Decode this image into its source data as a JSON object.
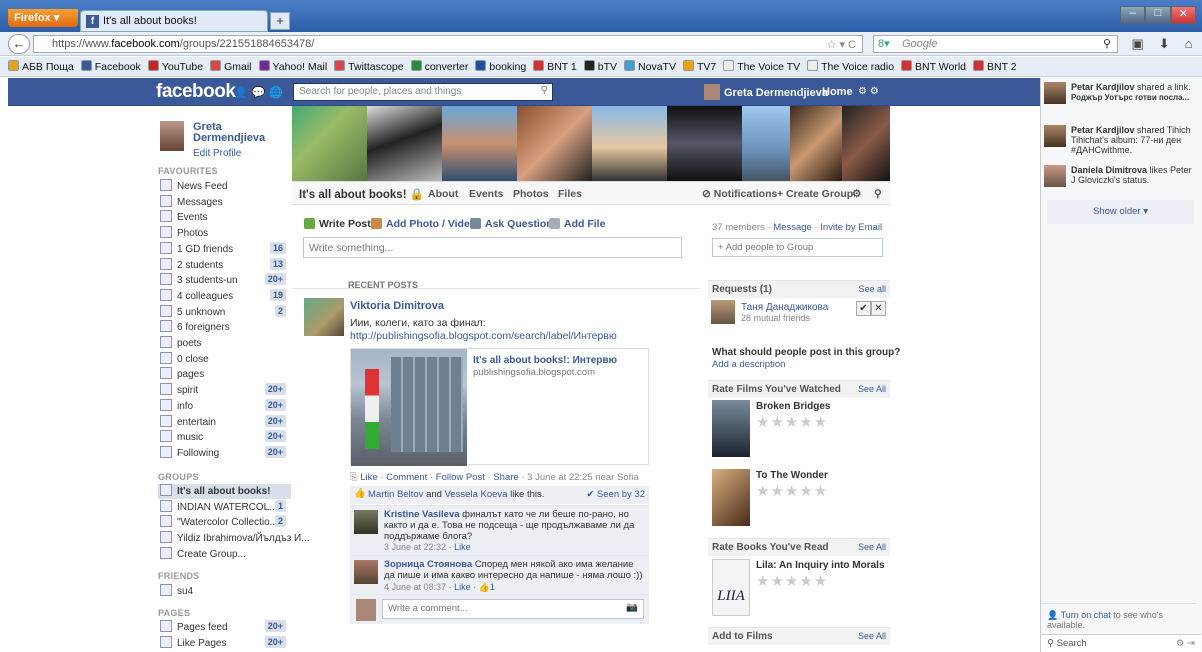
{
  "browser": {
    "menu_button": "Firefox",
    "tab_title": "It's all about books!",
    "url_prefix": "https://www.",
    "url_host": "facebook.com",
    "url_path": "/groups/221551884653478/",
    "search_engine_placeholder": "Google",
    "bookmarks": [
      {
        "label": "АБВ Поща",
        "color": "#e8a21a"
      },
      {
        "label": "Facebook",
        "color": "#3b5998"
      },
      {
        "label": "YouTube",
        "color": "#cc2222"
      },
      {
        "label": "Gmail",
        "color": "#d44"
      },
      {
        "label": "Yahoo! Mail",
        "color": "#6b2d91"
      },
      {
        "label": "Twittascope",
        "color": "#e04050"
      },
      {
        "label": "converter",
        "color": "#2a8a3a"
      },
      {
        "label": "booking",
        "color": "#1f4e9c"
      },
      {
        "label": "BNT 1",
        "color": "#c33"
      },
      {
        "label": "bTV",
        "color": "#222"
      },
      {
        "label": "NovaTV",
        "color": "#3aa0d8"
      },
      {
        "label": "TV7",
        "color": "#e8a21a"
      },
      {
        "label": "The Voice TV",
        "color": "#eee"
      },
      {
        "label": "The Voice radio",
        "color": "#eee"
      },
      {
        "label": "BNT World",
        "color": "#c33"
      },
      {
        "label": "BNT 2",
        "color": "#c33"
      }
    ]
  },
  "facebook": {
    "logo": "facebook",
    "search_placeholder": "Search for people, places and things",
    "user_name": "Greta Dermendjieva",
    "home": "Home"
  },
  "sidebar": {
    "profile_name": "Greta Dermendjieva",
    "edit_profile": "Edit Profile",
    "favourites_header": "FAVOURITES",
    "favourites": [
      {
        "label": "News Feed",
        "count": ""
      },
      {
        "label": "Messages",
        "count": ""
      },
      {
        "label": "Events",
        "count": ""
      },
      {
        "label": "Photos",
        "count": ""
      },
      {
        "label": "1 GD friends",
        "count": "16"
      },
      {
        "label": "2 students",
        "count": "13"
      },
      {
        "label": "3 students-un",
        "count": "20+"
      },
      {
        "label": "4 colleagues",
        "count": "19"
      },
      {
        "label": "5 unknown",
        "count": "2"
      },
      {
        "label": "6 foreigners",
        "count": ""
      },
      {
        "label": "poets",
        "count": ""
      },
      {
        "label": "0 close",
        "count": ""
      },
      {
        "label": "pages",
        "count": ""
      },
      {
        "label": "spirit",
        "count": "20+"
      },
      {
        "label": "info",
        "count": "20+"
      },
      {
        "label": "entertain",
        "count": "20+"
      },
      {
        "label": "music",
        "count": "20+"
      },
      {
        "label": "Following",
        "count": "20+"
      }
    ],
    "groups_header": "GROUPS",
    "groups": [
      {
        "label": "It's all about books!",
        "count": ""
      },
      {
        "label": "INDIAN WATERCOL...",
        "count": "1"
      },
      {
        "label": "\"Watercolor Collectio...",
        "count": "2"
      },
      {
        "label": "Yildiz Ibrahimova/Йълдъз И...",
        "count": ""
      },
      {
        "label": "Create Group...",
        "count": ""
      }
    ],
    "friends_header": "FRIENDS",
    "friends": [
      {
        "label": "su4",
        "count": ""
      }
    ],
    "pages_header": "PAGES",
    "pages": [
      {
        "label": "Pages feed",
        "count": "20+"
      },
      {
        "label": "Like Pages",
        "count": "20+"
      }
    ]
  },
  "group": {
    "title": "It's all about books!",
    "tabs": [
      "About",
      "Events",
      "Photos",
      "Files"
    ],
    "notifications": "Notifications",
    "create_group": "+ Create Group",
    "composer": [
      "Write Post",
      "Add Photo / Video",
      "Ask Question",
      "Add File"
    ],
    "write_placeholder": "Write something...",
    "recent_posts": "RECENT POSTS"
  },
  "post": {
    "author": "Viktoria Dimitrova",
    "text": "Иии, колеги, като за финал:",
    "link": "http://publishingsofia.blogspot.com/search/label/Интервю",
    "attachment_title": "It's all about books!: Интервю",
    "attachment_url": "publishingsofia.blogspot.com",
    "actions": {
      "like": "Like",
      "comment": "Comment",
      "follow": "Follow Post",
      "share": "Share",
      "meta": "3 June at 22:25 near Sofia"
    },
    "likers_a": "Martin Beltov",
    "likers_and": "and",
    "likers_b": "Vessela Koeva",
    "likers_suffix": "like this.",
    "seen_by": "Seen by 32",
    "comments": [
      {
        "name": "Kristine Vasileva",
        "text": "финалът като че ли беше по-рано, но както и да е. Това не подсеща - ще продължаваме ли да поддържаме блога?",
        "time": "3 June at 22:32",
        "like": "Like"
      },
      {
        "name": "Зорница Стоянова",
        "text": "Според мен някой ако има желание да пише и има какво интересно да напише - няма лошо :))",
        "time": "4 June at 08:37",
        "like": "Like",
        "likes": "1"
      }
    ],
    "write_comment": "Write a comment..."
  },
  "right": {
    "members": "37 members",
    "message": "Message",
    "invite": "Invite by Email",
    "add_people": "+ Add people to Group",
    "requests_header": "Requests (1)",
    "see_all": "See all",
    "request_name": "Таня Данаджикова",
    "request_mutual": "28 mutual friends",
    "what_post": "What should people post in this group?",
    "add_description": "Add a description",
    "rate_films_header": "Rate Films You've Watched",
    "see_all_2": "See All",
    "films": [
      "Broken Bridges",
      "To The Wonder"
    ],
    "rate_books_header": "Rate Books You've Read",
    "see_all_3": "See All",
    "book": "Lila: An Inquiry into Morals",
    "add_films_header": "Add to Films",
    "see_all_4": "See All"
  },
  "ticker": {
    "items": [
      {
        "name": "Petar Kardjilov",
        "text": "shared a link.",
        "sub": "Роджър Уотърс готви посла..."
      },
      {
        "name": "Petar Kardjilov",
        "text": "shared Tihich Tihichat's album: 77-ни ден #ДАНСwithme."
      },
      {
        "name": "Daniela Dimitrova",
        "text": "likes Peter J Gloviczki's status."
      }
    ],
    "show_older": "Show older",
    "chat_link": "Turn on chat",
    "chat_text": "to see who's available.",
    "search": "Search"
  }
}
